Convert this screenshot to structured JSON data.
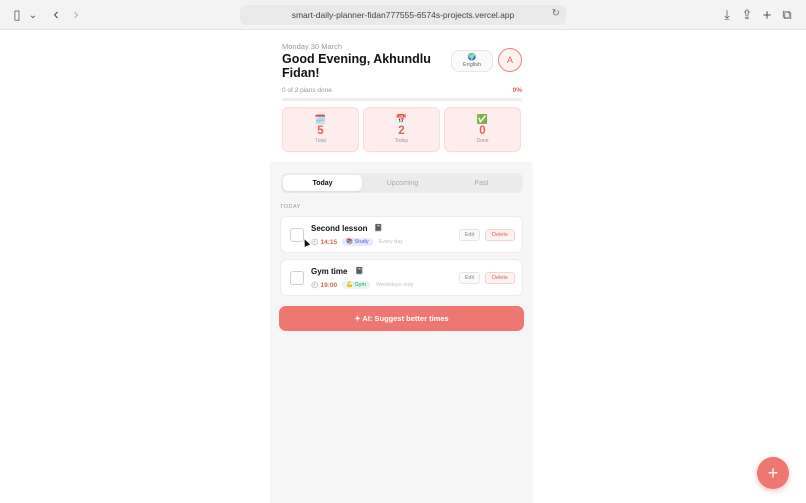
{
  "browser": {
    "url": "smart-daily-planner-fidan777555-6574s-projects.vercel.app",
    "icons": {
      "sidebar": "▯",
      "chevron": "⌄",
      "back": "‹",
      "forward": "›",
      "reload": "↻",
      "download": "⤓",
      "share": "⇪",
      "new_tab": "+",
      "tabs": "⧉"
    }
  },
  "header": {
    "date": "Monday 30 March",
    "greeting": "Good Evening, Akhundlu Fidan!",
    "language_icon": "🌍",
    "language_label": "English",
    "avatar_initial": "A"
  },
  "progress": {
    "text": "0 of 2 plans done",
    "percent_label": "0%",
    "fraction": 0
  },
  "stats": [
    {
      "icon": "🗓️",
      "value": "5",
      "label": "Total"
    },
    {
      "icon": "📅",
      "value": "2",
      "label": "Today"
    },
    {
      "icon": "✅",
      "value": "0",
      "label": "Done"
    }
  ],
  "tabs": [
    {
      "label": "Today",
      "active": true
    },
    {
      "label": "Upcoming",
      "active": false
    },
    {
      "label": "Past",
      "active": false
    }
  ],
  "section_label": "TODAY",
  "plans": [
    {
      "title": "Second lesson",
      "title_icon": "📓",
      "clock_icon": "🕘",
      "time": "14:15",
      "tag_icon": "📚",
      "tag": "Study",
      "tag_color": "#4a5bd8",
      "repeat": "Every day",
      "edit_label": "Edit",
      "delete_label": "Delete"
    },
    {
      "title": "Gym time",
      "title_icon": "📓",
      "clock_icon": "🕘",
      "time": "19:00",
      "tag_icon": "💪",
      "tag": "Gym",
      "tag_color": "#24a36b",
      "repeat": "Weekdays only",
      "edit_label": "Edit",
      "delete_label": "Delete"
    }
  ],
  "ai_button_label": "✦ AI: Suggest better times",
  "fab_label": "+",
  "colors": {
    "accent": "#ef7772",
    "accent_text": "#e0605a"
  }
}
